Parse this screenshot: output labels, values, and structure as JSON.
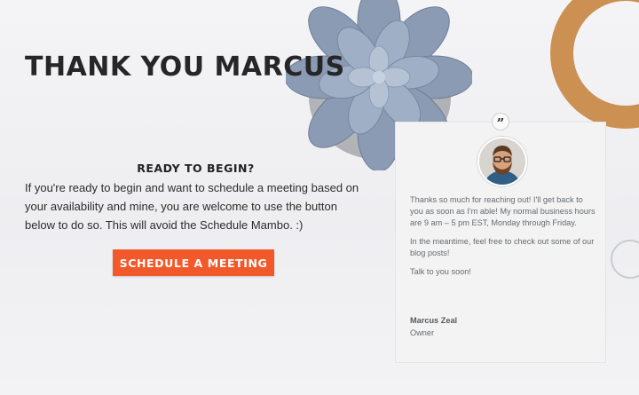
{
  "hero": {
    "title": "THANK YOU MARCUS"
  },
  "cta_section": {
    "heading": "READY TO BEGIN?",
    "body": "If you're ready to begin and want to schedule a meeting based on your availability and mine, you are welcome to use the button below to do so. This will avoid the Schedule Mambo. :)",
    "button_label": "SCHEDULE A MEETING"
  },
  "message_card": {
    "quote_icon": "quote-icon",
    "paragraphs": [
      "Thanks so much for reaching out! I'll get back to you as soon as I'm able! My normal business hours are 9 am – 5 pm EST, Monday through Friday.",
      "In the meantime, feel free to check out some of our blog posts!",
      "Talk to you soon!"
    ],
    "signature_name": "Marcus Zeal",
    "signature_role": "Owner"
  },
  "colors": {
    "accent": "#f2592a",
    "title": "#262628",
    "card_background": "#f3f3f3"
  }
}
